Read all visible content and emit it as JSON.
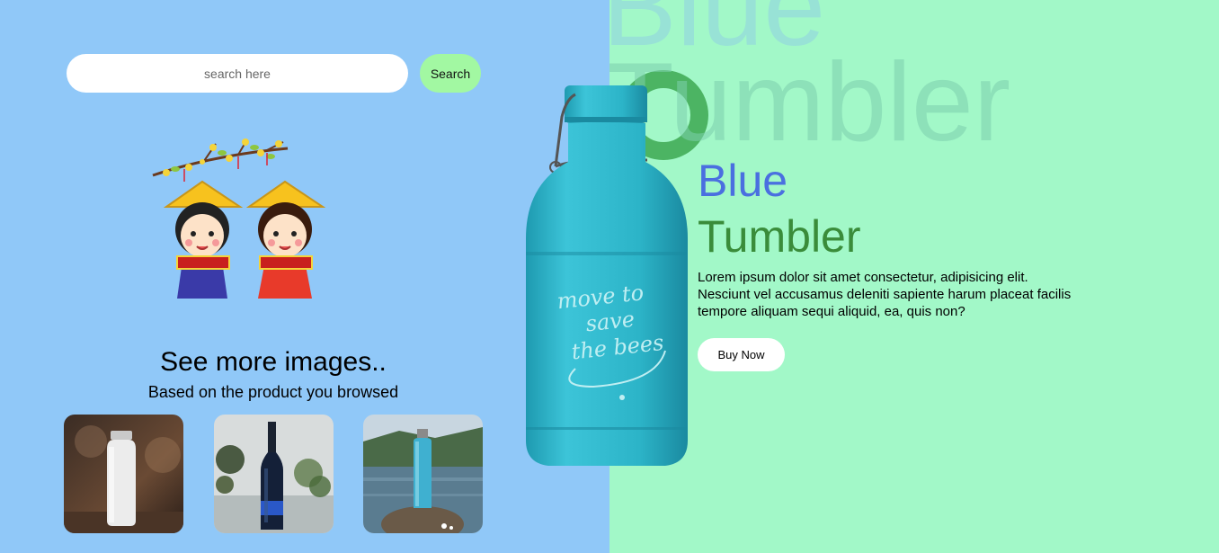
{
  "search": {
    "placeholder": "search here",
    "button_label": "Search"
  },
  "gallery": {
    "title": "See more images..",
    "subtitle": "Based on the product you browsed",
    "images": [
      {
        "icon": "white-bottle-photo"
      },
      {
        "icon": "dark-glass-bottle-photo"
      },
      {
        "icon": "blue-bottle-on-rock-photo"
      }
    ]
  },
  "hero": {
    "background_word_1": "Blue",
    "background_word_2": "Tumbler",
    "title_line_1": "Blue",
    "title_line_2": "Tumbler",
    "description": "Lorem ipsum dolor sit amet consectetur, adipisicing elit. Nesciunt vel accusamus deleniti sapiente harum placeat facilis tempore aliquam sequi aliquid, ea, quis non?",
    "buy_label": "Buy Now",
    "product_bottle_text": [
      "move to",
      "save",
      "the bees"
    ]
  },
  "colors": {
    "left_bg": "#90c8f8",
    "right_bg": "#a2f8c8",
    "accent_blue": "#4a6fe0",
    "accent_green": "#3a8c3a",
    "bottle": "#2cb4c8"
  }
}
